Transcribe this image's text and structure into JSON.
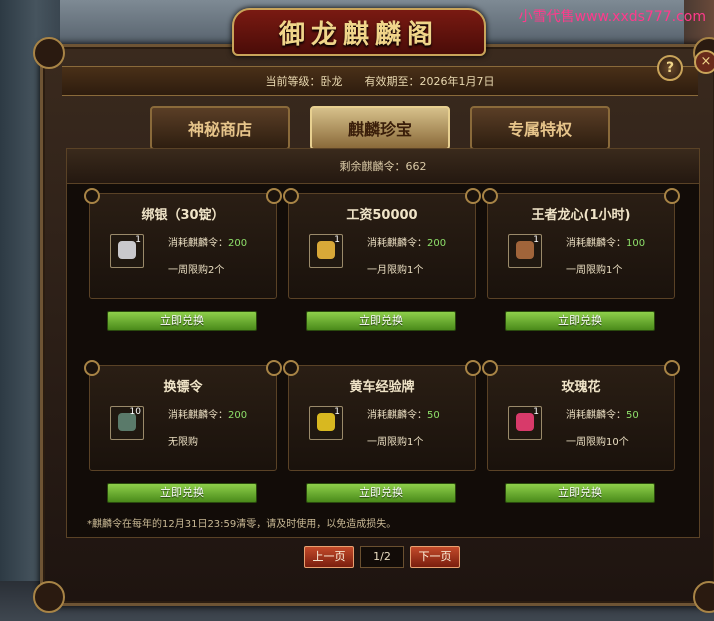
{
  "watermark": "小雪代售www.xxds777.com",
  "title": "御龙麒麟阁",
  "help_icon": "?",
  "close_icon": "×",
  "info": {
    "level": "当前等级：卧龙",
    "expiry": "有效期至：2026年1月7日"
  },
  "tabs": [
    {
      "label": "神秘商店",
      "active": false
    },
    {
      "label": "麒麟珍宝",
      "active": true
    },
    {
      "label": "专属特权",
      "active": false
    }
  ],
  "tokens_remaining": "剩余麒麟令：662",
  "items": [
    {
      "name": "绑银（30锭）",
      "qty": "1",
      "cost_label": "消耗麒麟令：",
      "cost": "200",
      "limit": "一周限购2个",
      "button": "立即兑换",
      "icon": "silver-ingot-icon",
      "color": "#c8c8cc"
    },
    {
      "name": "工资50000",
      "qty": "1",
      "cost_label": "消耗麒麟令：",
      "cost": "200",
      "limit": "一月限购1个",
      "button": "立即兑换",
      "icon": "gold-ingot-icon",
      "color": "#d8a838"
    },
    {
      "name": "王者龙心(1小时)",
      "qty": "1",
      "cost_label": "消耗麒麟令：",
      "cost": "100",
      "limit": "一周限购1个",
      "button": "立即兑换",
      "icon": "dragon-heart-icon",
      "color": "#a0643a"
    },
    {
      "name": "换镖令",
      "qty": "10",
      "cost_label": "消耗麒麟令：",
      "cost": "200",
      "limit": "无限购",
      "button": "立即兑换",
      "icon": "escort-token-icon",
      "color": "#5a7a6a"
    },
    {
      "name": "黄车经验牌",
      "qty": "1",
      "cost_label": "消耗麒麟令：",
      "cost": "50",
      "limit": "一周限购1个",
      "button": "立即兑换",
      "icon": "yellow-cart-icon",
      "color": "#d8b820"
    },
    {
      "name": "玫瑰花",
      "qty": "1",
      "cost_label": "消耗麒麟令：",
      "cost": "50",
      "limit": "一周限购10个",
      "button": "立即兑换",
      "icon": "rose-icon",
      "color": "#d83a6a"
    }
  ],
  "notice": "*麒麟令在每年的12月31日23:59清零，请及时使用，以免造成损失。",
  "pager": {
    "prev": "上一页",
    "page": "1/2",
    "next": "下一页"
  }
}
